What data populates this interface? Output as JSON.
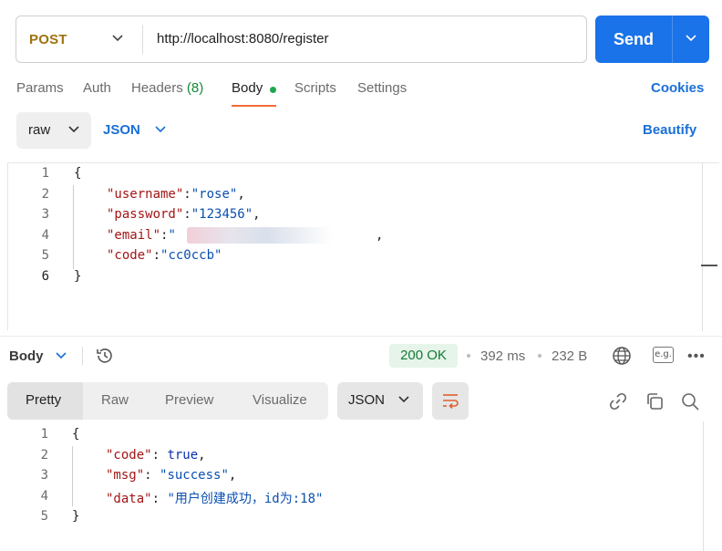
{
  "request": {
    "method": "POST",
    "url": "http://localhost:8080/register",
    "send_label": "Send"
  },
  "tabs": [
    {
      "label": "Params"
    },
    {
      "label": "Auth"
    },
    {
      "label": "Headers",
      "count": "(8)"
    },
    {
      "label": "Body"
    },
    {
      "label": "Scripts"
    },
    {
      "label": "Settings"
    }
  ],
  "cookies_label": "Cookies",
  "body_options": {
    "mode": "raw",
    "language": "JSON",
    "beautify_label": "Beautify"
  },
  "request_body": {
    "line_numbers": [
      "1",
      "2",
      "3",
      "4",
      "5",
      "6"
    ],
    "open_brace": "{",
    "close_brace": "}",
    "username_key": "\"username\"",
    "username_value": "\"rose\"",
    "password_key": "\"password\"",
    "password_value": "\"123456\"",
    "email_key": "\"email\"",
    "email_value_start": "\"",
    "code_key": "\"code\"",
    "code_value": "\"cc0ccb\""
  },
  "response": {
    "body_label": "Body",
    "status": "200 OK",
    "time": "392 ms",
    "size": "232 B",
    "eg_label": "e.g.",
    "more_label": "•••",
    "view_tabs": [
      {
        "label": "Pretty"
      },
      {
        "label": "Raw"
      },
      {
        "label": "Preview"
      },
      {
        "label": "Visualize"
      }
    ],
    "format": "JSON",
    "line_numbers": [
      "1",
      "2",
      "3",
      "4",
      "5"
    ],
    "open_brace": "{",
    "close_brace": "}",
    "code_key": "\"code\"",
    "code_value": "true",
    "msg_key": "\"msg\"",
    "msg_value": "\"success\"",
    "data_key": "\"data\"",
    "data_value": "\"用户创建成功，id为:18\""
  },
  "colors": {
    "accent": "#1a73e8",
    "method": "#a0720e",
    "status_green": "#137a35",
    "active_tab_underline": "#f26b3a"
  }
}
